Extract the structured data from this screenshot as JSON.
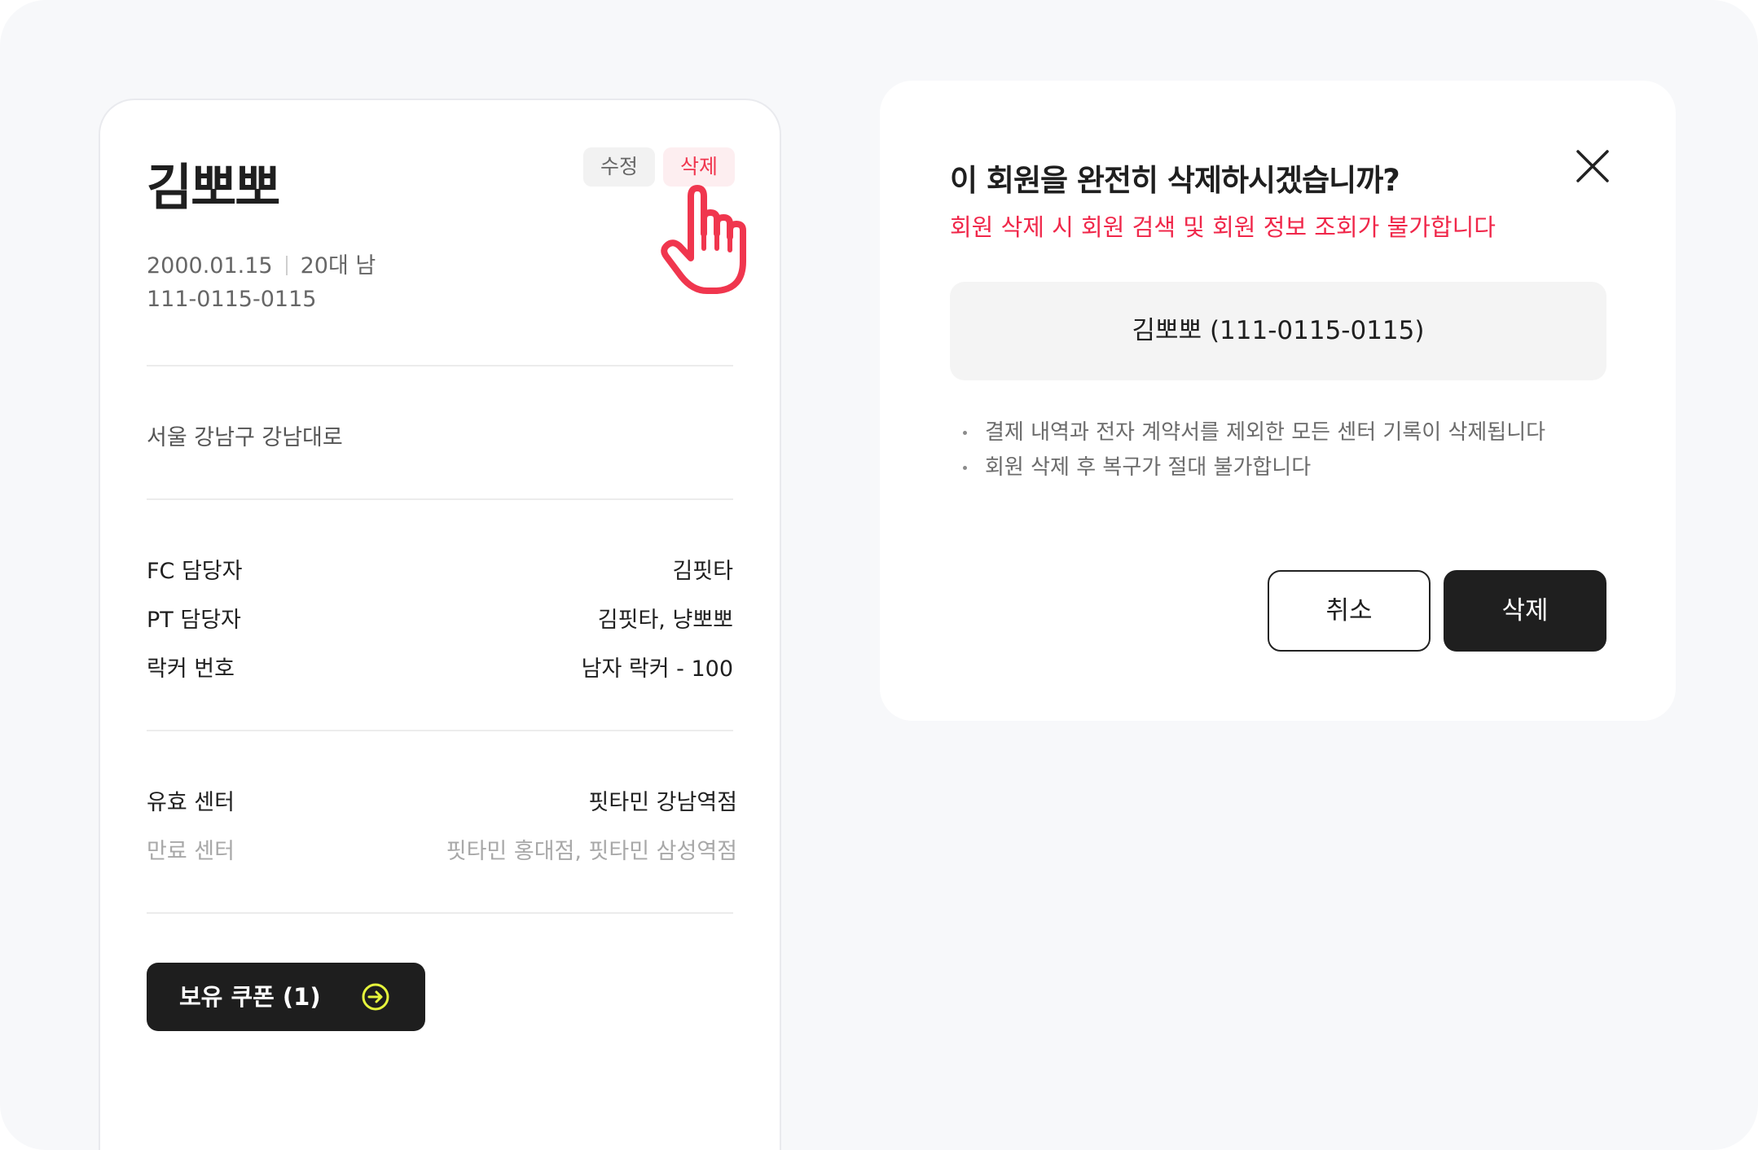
{
  "member": {
    "name": "김뽀뽀",
    "edit_label": "수정",
    "delete_label": "삭제",
    "birth": "2000.01.15",
    "age_gender": "20대 남",
    "phone": "111-0115-0115",
    "address": "서울 강남구 강남대로",
    "staff_rows": [
      {
        "label": "FC 담당자",
        "value": "김핏타"
      },
      {
        "label": "PT 담당자",
        "value": "김핏타, 냥뽀뽀"
      },
      {
        "label": "락커 번호",
        "value": "남자 락커 - 100"
      }
    ],
    "center_rows": [
      {
        "label": "유효 센터",
        "value": "핏타민 강남역점"
      },
      {
        "label": "만료 센터",
        "value": "핏타민 홍대점, 핏타민 삼성역점"
      }
    ],
    "coupon_label": "보유 쿠폰 (1)"
  },
  "modal": {
    "title": "이 회원을 완전히 삭제하시겠습니까?",
    "warning": "회원 삭제 시 회원 검색 및 회원 정보 조회가 불가합니다",
    "target": "김뽀뽀 (111-0115-0115)",
    "notes": [
      "결제 내역과 전자 계약서를 제외한 모든 센터 기록이 삭제됩니다",
      "회원 삭제 후 복구가 절대 불가합니다"
    ],
    "cancel_label": "취소",
    "confirm_label": "삭제"
  },
  "colors": {
    "accent_red": "#f0274a",
    "dark_button": "#1f1f1f",
    "coupon_icon": "#e6f53c",
    "background": "#f7f8fa"
  },
  "icons": {
    "pointer": "hand-pointer-icon",
    "close": "close-icon",
    "coupon_arrow": "arrow-right-circle-icon"
  }
}
